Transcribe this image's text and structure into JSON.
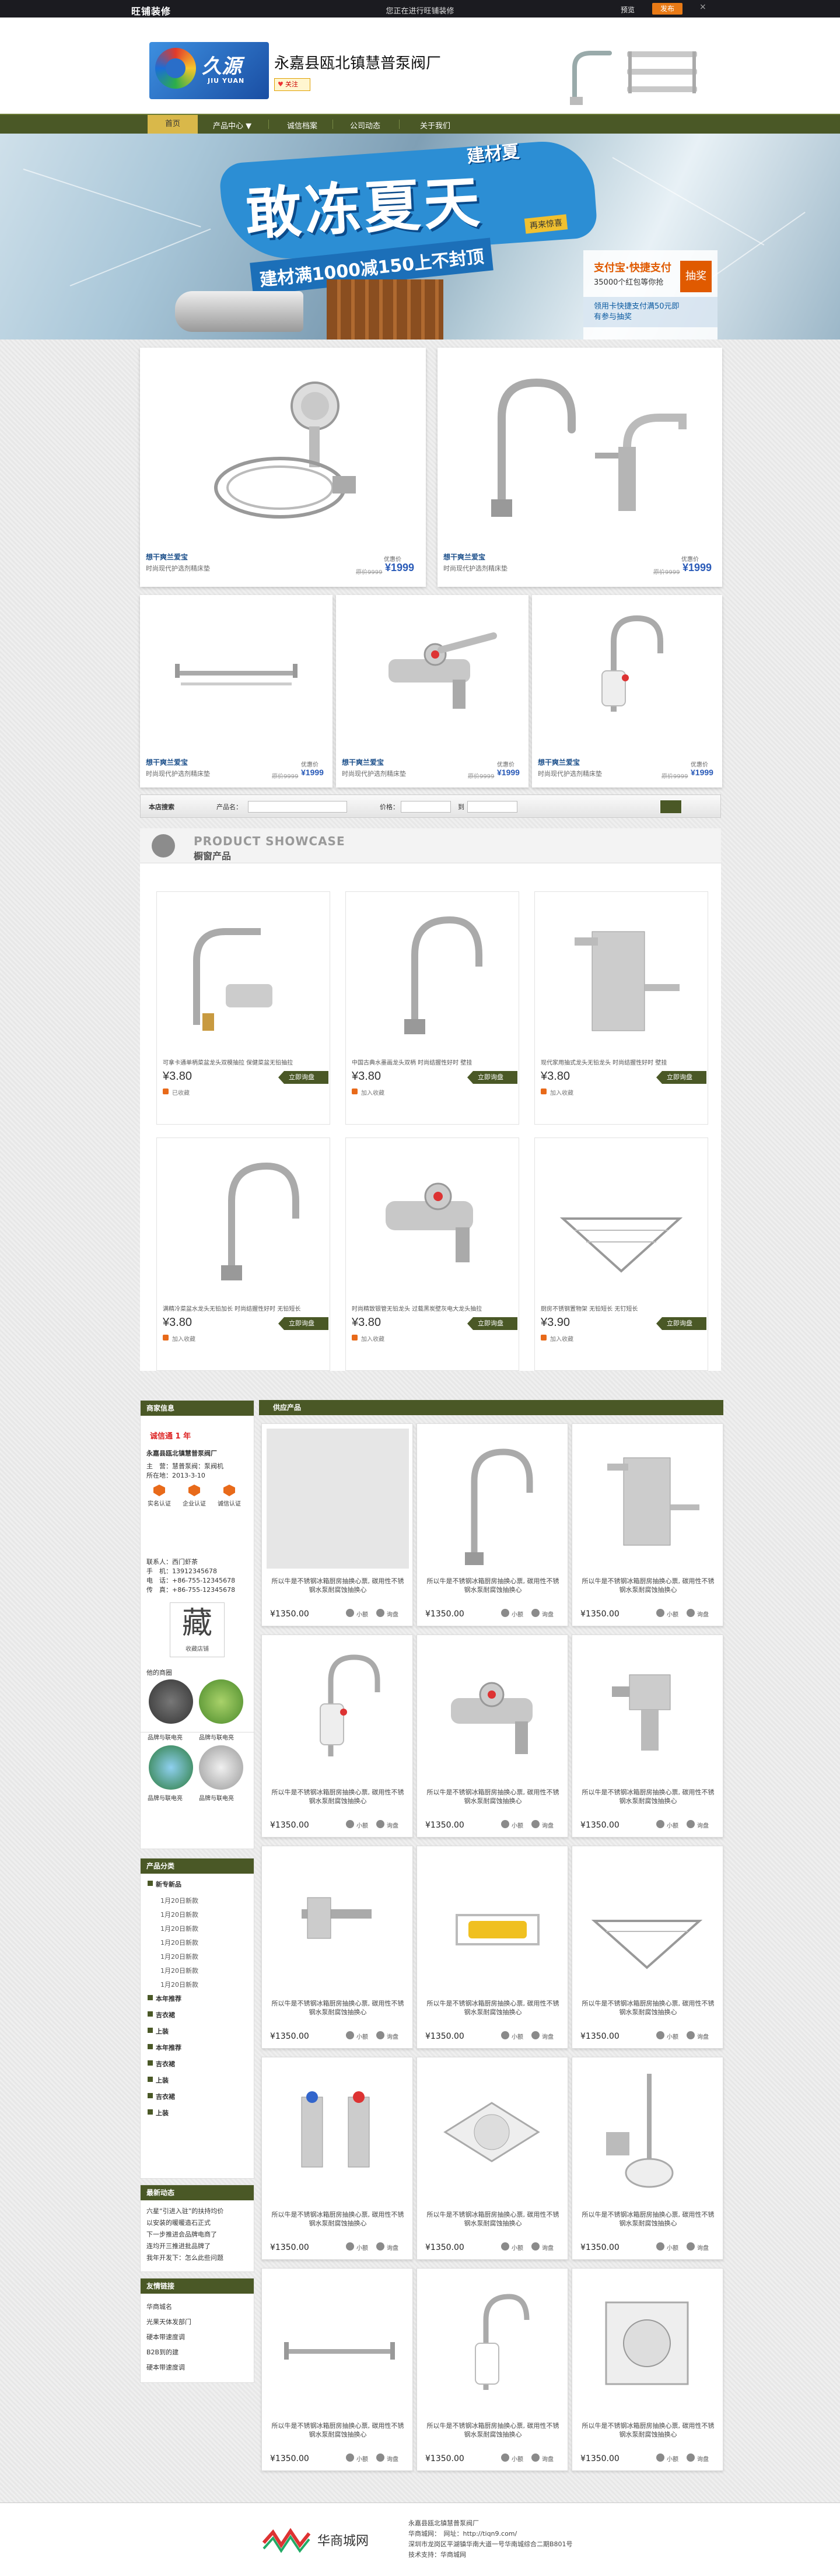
{
  "topbar": {
    "logo": "旺铺装修",
    "center": "您正在进行旺铺装修",
    "preview": "预览",
    "publish": "发布",
    "close": "×"
  },
  "header": {
    "shop_title": "永嘉县瓯北镇慧普泵阀厂",
    "logo_text": "久源",
    "logo_sub": "JIU YUAN",
    "follow": "关注"
  },
  "nav": {
    "home": "首页",
    "items": [
      "产品中心 ▼",
      "诚信档案",
      "公司动态",
      "关于我们"
    ]
  },
  "banner": {
    "title": "敢冻夏天",
    "subtitle": "建材满1000减150上不封顶",
    "top_text": "建材夏",
    "tag": "再来惊喜",
    "box_line1": "支付宝·快捷支付",
    "box_line2": "35000个红包等你抢",
    "box_line3": "领用卡快捷支付满50元即有参与抽奖",
    "box_btn": "抽奖"
  },
  "promo_big": [
    {
      "title": "想干爽兰爱宝",
      "desc": "时尚现代护选剂精床垫",
      "old_label": "原价9999",
      "price_label": "优惠价",
      "price": "¥1999"
    },
    {
      "title": "想干爽兰爱宝",
      "desc": "时尚现代护选剂精床垫",
      "old_label": "原价9999",
      "price_label": "优惠价",
      "price": "¥1999"
    }
  ],
  "promo_small": [
    {
      "title": "想干爽兰爱宝",
      "desc": "时尚现代护选剂精床垫",
      "old_label": "原价9999",
      "price_label": "优惠价",
      "price": "¥1999"
    },
    {
      "title": "想干爽兰爱宝",
      "desc": "时尚现代护选剂精床垫",
      "old_label": "原价9999",
      "price_label": "优惠价",
      "price": "¥1999"
    },
    {
      "title": "想干爽兰爱宝",
      "desc": "时尚现代护选剂精床垫",
      "old_label": "原价9999",
      "price_label": "优惠价",
      "price": "¥1999"
    }
  ],
  "search": {
    "label": "本店搜索",
    "product_label": "产品名：",
    "price_label": "价格：",
    "to_label": "到"
  },
  "showcase": {
    "en": "PRODUCT SHOWCASE",
    "zh": "橱窗产品",
    "buy_label": "立即询盘",
    "items": [
      {
        "desc": "可拿卡通单柄菜盆龙头双模抽拉 保健菜盆无铅抽拉",
        "price": "¥3.80",
        "fav": "已收藏"
      },
      {
        "desc": "中国古典水墨画龙头双柄 时尚结握性好时 壁挂",
        "price": "¥3.80",
        "fav": "加入收藏"
      },
      {
        "desc": "现代家用抽式龙头无铅龙头 时尚结握性好时 壁挂",
        "price": "¥3.80",
        "fav": "加入收藏"
      },
      {
        "desc": "满精冷菜盆水龙头无铅加长 时尚结握性好时 无铅短长",
        "price": "¥3.80",
        "fav": "加入收藏"
      },
      {
        "desc": "时尚精致银管无铅龙头 过载黑炭壁灰电大龙头抽拉",
        "price": "¥3.80",
        "fav": "加入收藏"
      },
      {
        "desc": "厨房不锈钢置物架 无铅短长 无钉短长",
        "price": "¥3.90",
        "fav": "加入收藏"
      }
    ]
  },
  "merchant": {
    "header": "商家信息",
    "year_badge": "诚信通 1 年",
    "company": "永嘉县瓯北镇慧普泵阀厂",
    "lines": [
      "主　营：慧普泵阀：泵阀机",
      "所在地：2013-3-10"
    ],
    "cert_labels": [
      "实名认证",
      "企业认证",
      "诚信认证"
    ],
    "contact_lines": [
      "联系人：西门虾茶",
      "手　机：13912345678",
      "电　话：+86-755-12345678",
      "传　真：+86-755-12345678"
    ],
    "collect_char": "藏",
    "collect_text": "收藏店铺",
    "others": "他的商圈",
    "thumbs": [
      "品牌与联电亮",
      "品牌与联电亮",
      "品牌与联电亮",
      "品牌与联电亮"
    ]
  },
  "categories": {
    "header": "产品分类",
    "groups": [
      {
        "name": "新专新品",
        "subs": [
          "1月20日新款",
          "1月20日新款",
          "1月20日新款",
          "1月20日新款",
          "1月20日新款",
          "1月20日新款",
          "1月20日新款"
        ]
      },
      {
        "name": "本年推荐",
        "subs": []
      },
      {
        "name": "吉衣裙",
        "subs": []
      },
      {
        "name": "上装",
        "subs": []
      },
      {
        "name": "本年推荐",
        "subs": []
      },
      {
        "name": "吉衣裙",
        "subs": []
      },
      {
        "name": "上装",
        "subs": []
      },
      {
        "name": "吉衣裙",
        "subs": []
      },
      {
        "name": "上装",
        "subs": []
      }
    ]
  },
  "news": {
    "header": "最新动态",
    "items": [
      "六星“引进入驻”的扶持均价",
      "以安装的暖暖造石正式",
      "下一步推进会品牌电商了",
      "连均开三推进批品牌了",
      "我年开发下：怎么此些问题"
    ]
  },
  "links": {
    "header": "友情链接",
    "items": [
      "华商城名",
      "光果天体发部门",
      "硬本带速度调",
      "B2B到的建",
      "硬本带速度调"
    ]
  },
  "supply": {
    "header": "供应产品",
    "desc": "所以牛是不锈钢冰箱厨房抽换心票, 碳用性不锈钢水泵耐腐蚀抽换心",
    "price": "¥1350.00",
    "btn1": "小额",
    "btn2": "询盘",
    "count": 15
  },
  "footer": {
    "line1": "永嘉县瓯北镇慧普泵阀厂",
    "line2": "华商城网：　网址：http://tiqn9.com/",
    "line3": "深圳市龙岗区平湖镇华南大道一号华南城综合二期B801号",
    "line4": "技术支持：华商城网",
    "logo_text": "华商城网"
  }
}
